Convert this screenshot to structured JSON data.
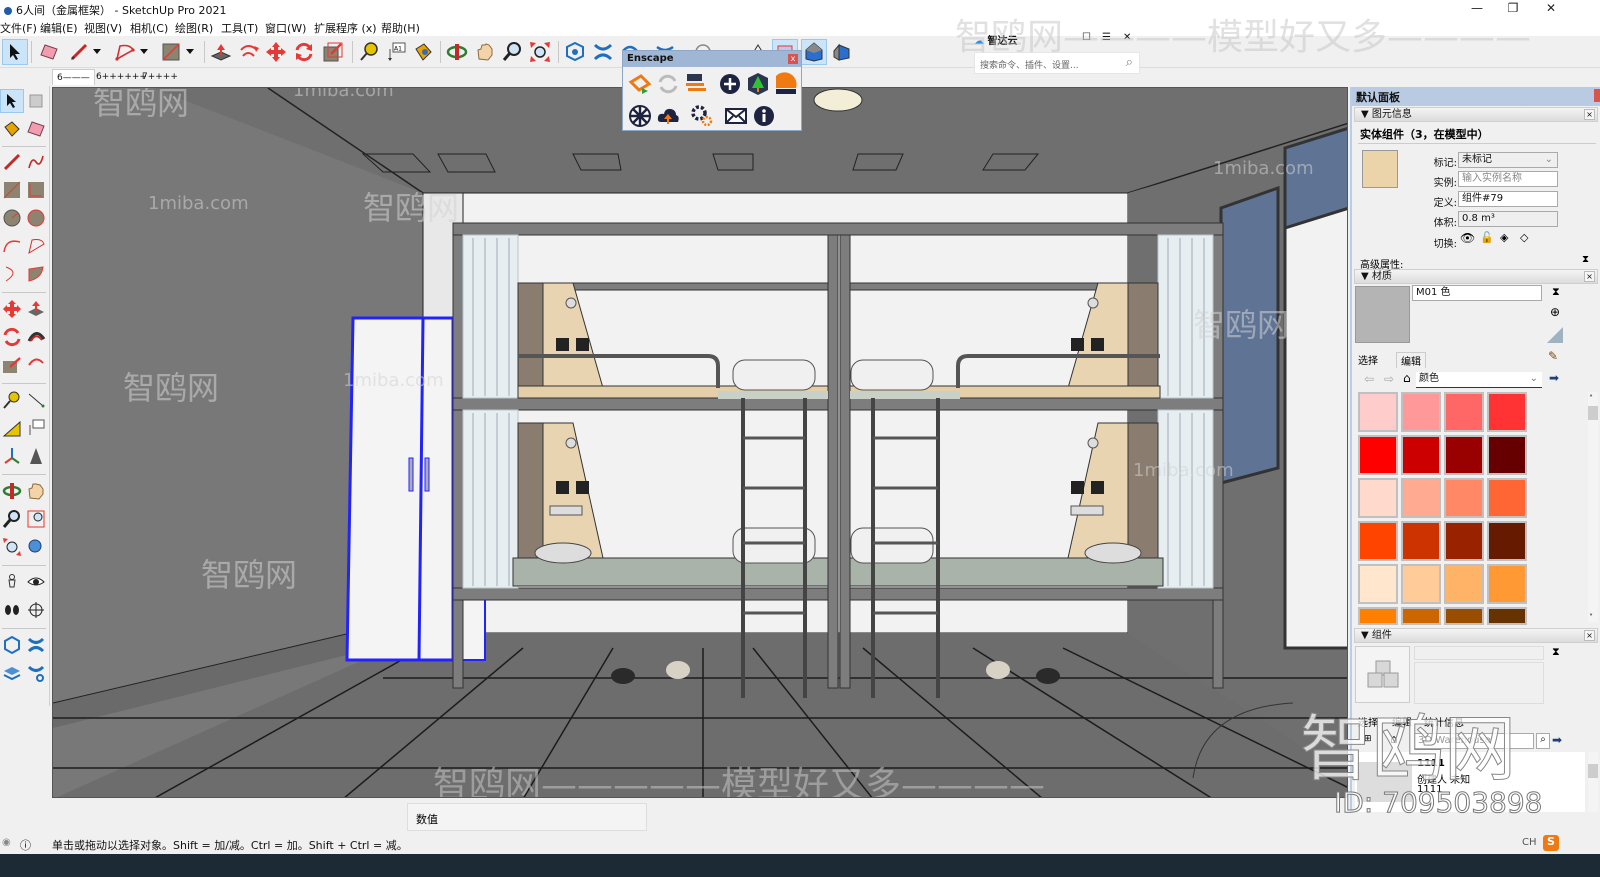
{
  "window": {
    "title": "6人间（金属框架） - SketchUp Pro 2021",
    "controls": {
      "minimize": "—",
      "restore": "❐",
      "close": "✕"
    }
  },
  "menubar": [
    "文件(F)",
    "编辑(E)",
    "视图(V)",
    "相机(C)",
    "绘图(R)",
    "工具(T)",
    "窗口(W)",
    "扩展程序 (x)",
    "帮助(H)"
  ],
  "toolbar": {
    "icons": [
      "select-icon",
      "eraser-icon",
      "pencil-icon",
      "dropdown",
      "arc-icon",
      "dropdown",
      "rectangle-icon",
      "dropdown",
      "push-pull-icon",
      "follow-me-icon",
      "move-icon",
      "rotate-icon",
      "scale-icon",
      "tape-measure-icon",
      "text-label-icon",
      "paint-bucket-icon",
      "orbit-icon",
      "pan-icon",
      "zoom-icon",
      "zoom-extents-icon",
      "warehouse-icon",
      "extension-icon",
      "sandbox-icon",
      "sandbox2-icon",
      "section-icon",
      "style-icon",
      "house-front-icon",
      "house-iso-icon",
      "house-right-icon"
    ]
  },
  "scenes": [
    {
      "label": "6———",
      "selected": true
    },
    {
      "label": "6++++++",
      "selected": false
    },
    {
      "label": "7++++",
      "selected": false
    }
  ],
  "enscape": {
    "title": "Enscape",
    "close": "x",
    "buttons_row1": [
      "start-enscape-icon",
      "live-update-icon",
      "sync-views-icon",
      "add-asset-icon",
      "asset-library-icon",
      "material-editor-icon"
    ],
    "buttons_row2": [
      "panorama-icon",
      "upload-icon",
      "settings-icon",
      "feedback-icon",
      "about-icon"
    ]
  },
  "zhida": {
    "title": "智达云",
    "search_placeholder": "搜索命令、插件、设置..."
  },
  "tray": {
    "title": "默认面板",
    "entity_info": {
      "header": "图元信息",
      "object_title": "实体组件（3，在模型中）",
      "tag_label": "标记:",
      "tag_value": "未标记",
      "instance_label": "实例:",
      "instance_placeholder": "输入实例名称",
      "definition_label": "定义:",
      "definition_value": "组件#79",
      "volume_label": "体积:",
      "volume_value": "0.8 m³",
      "toggles_label": "切换:",
      "advanced_label": "高级属性:"
    },
    "materials": {
      "header": "材质",
      "name": "M01 色",
      "tabs": [
        "选择",
        "编辑"
      ],
      "library": "颜色",
      "swatches": [
        "#ffcccc",
        "#ff9999",
        "#ff6666",
        "#ff3333",
        "#ff0000",
        "#cc0000",
        "#990000",
        "#660000",
        "#ffd9cc",
        "#ffaa91",
        "#ff8966",
        "#ff6633",
        "#ff4400",
        "#cc3300",
        "#992200",
        "#661a00",
        "#ffe6cc",
        "#ffcc99",
        "#ffb366",
        "#ff9933",
        "#ff8000",
        "#cc6600",
        "#994d00",
        "#663300"
      ]
    },
    "components": {
      "header": "组件",
      "tabs": [
        "选择",
        "编辑",
        "统计信息"
      ],
      "search_placeholder": "3D Warehouse",
      "result_title": "1111",
      "result_creator": "创建人 未知",
      "result_desc": "1111"
    }
  },
  "valuebox": {
    "label": "数值"
  },
  "statusbar": {
    "message": "单击或拖动以选择对象。Shift = 加/减。Ctrl = 加。Shift + Ctrl = 减。"
  },
  "ime": {
    "lang": "CH"
  },
  "watermarks": {
    "top": "智鸥网————模型好又多————",
    "bottom": "智鸥网—————模型好又多————",
    "site": "1miba.com",
    "id": "ID: 709503898",
    "big": "智鸥网"
  }
}
